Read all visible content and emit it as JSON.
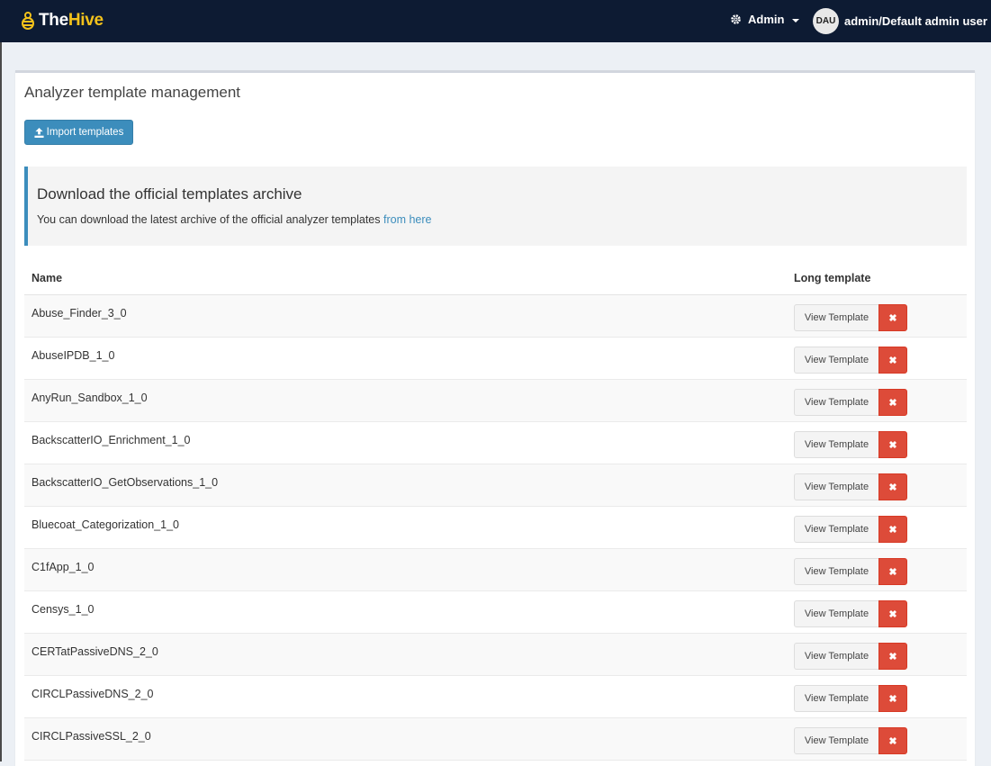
{
  "navbar": {
    "brand_the": "The",
    "brand_hive": "Hive",
    "admin_label": "Admin",
    "avatar_initials": "DAU",
    "user_label": "admin/Default admin user"
  },
  "page": {
    "title": "Analyzer template management",
    "import_button": "Import templates"
  },
  "callout": {
    "title": "Download the official templates archive",
    "text": "You can download the latest archive of the official analyzer templates",
    "link": "from here"
  },
  "table": {
    "columns": [
      "Name",
      "Long template"
    ],
    "view_label": "View Template",
    "delete_glyph": "✖",
    "rows": [
      "Abuse_Finder_3_0",
      "AbuseIPDB_1_0",
      "AnyRun_Sandbox_1_0",
      "BackscatterIO_Enrichment_1_0",
      "BackscatterIO_GetObservations_1_0",
      "Bluecoat_Categorization_1_0",
      "C1fApp_1_0",
      "Censys_1_0",
      "CERTatPassiveDNS_2_0",
      "CIRCLPassiveDNS_2_0",
      "CIRCLPassiveSSL_2_0"
    ]
  },
  "icons": {
    "brand": "bee-icon",
    "admin": "gear-icon",
    "dropdown": "caret-down-icon",
    "import": "upload-icon",
    "delete": "close-icon"
  },
  "colors": {
    "navbar": "#0d1b33",
    "brand_accent": "#f3c21b",
    "primary": "#3c8dbc",
    "danger": "#dd4b39"
  }
}
